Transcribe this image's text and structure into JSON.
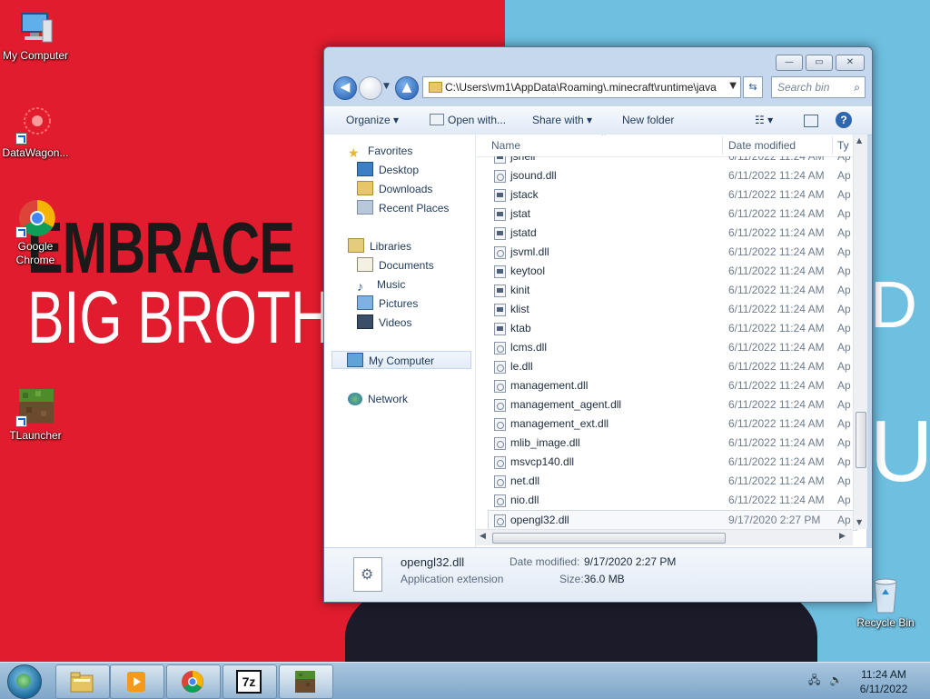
{
  "desktop": {
    "wallpaper": {
      "line1": "EMBRACE",
      "line2": "BIG BROTHER",
      "right_fragment1": "D",
      "right_fragment2": "UD",
      "colors": {
        "left": "#e11c2e",
        "right": "#6fbfe1"
      }
    },
    "icons": [
      {
        "label": "My Computer",
        "icon": "computer-icon"
      },
      {
        "label": "DataWagon...",
        "icon": "datawagon-icon"
      },
      {
        "label": "Google Chrome",
        "icon": "chrome-icon"
      },
      {
        "label": "TLauncher",
        "icon": "grass-block-icon"
      },
      {
        "label": "Recycle Bin",
        "icon": "recycle-bin-icon"
      }
    ]
  },
  "window": {
    "caption_buttons": {
      "minimize": "—",
      "maximize": "▭",
      "close": "✕"
    },
    "address": "C:\\Users\\vm1\\AppData\\Roaming\\.minecraft\\runtime\\java",
    "search_placeholder": "Search bin",
    "toolbar": {
      "organize": "Organize ▾",
      "open_with": "Open with...",
      "share_with": "Share with ▾",
      "new_folder": "New folder",
      "views": "☷ ▾"
    },
    "nav": {
      "favorites": "Favorites",
      "desktop": "Desktop",
      "downloads": "Downloads",
      "recent": "Recent Places",
      "libraries": "Libraries",
      "documents": "Documents",
      "music": "Music",
      "pictures": "Pictures",
      "videos": "Videos",
      "computer": "My Computer",
      "network": "Network"
    },
    "columns": {
      "name": "Name",
      "date": "Date modified",
      "type": "Ty"
    },
    "files": [
      {
        "name": "jshell",
        "date": "6/11/2022 11:24 AM",
        "type": "Ap",
        "kind": "exe"
      },
      {
        "name": "jsound.dll",
        "date": "6/11/2022 11:24 AM",
        "type": "Ap",
        "kind": "dll"
      },
      {
        "name": "jstack",
        "date": "6/11/2022 11:24 AM",
        "type": "Ap",
        "kind": "exe"
      },
      {
        "name": "jstat",
        "date": "6/11/2022 11:24 AM",
        "type": "Ap",
        "kind": "exe"
      },
      {
        "name": "jstatd",
        "date": "6/11/2022 11:24 AM",
        "type": "Ap",
        "kind": "exe"
      },
      {
        "name": "jsvml.dll",
        "date": "6/11/2022 11:24 AM",
        "type": "Ap",
        "kind": "dll"
      },
      {
        "name": "keytool",
        "date": "6/11/2022 11:24 AM",
        "type": "Ap",
        "kind": "exe"
      },
      {
        "name": "kinit",
        "date": "6/11/2022 11:24 AM",
        "type": "Ap",
        "kind": "exe"
      },
      {
        "name": "klist",
        "date": "6/11/2022 11:24 AM",
        "type": "Ap",
        "kind": "exe"
      },
      {
        "name": "ktab",
        "date": "6/11/2022 11:24 AM",
        "type": "Ap",
        "kind": "exe"
      },
      {
        "name": "lcms.dll",
        "date": "6/11/2022 11:24 AM",
        "type": "Ap",
        "kind": "dll"
      },
      {
        "name": "le.dll",
        "date": "6/11/2022 11:24 AM",
        "type": "Ap",
        "kind": "dll"
      },
      {
        "name": "management.dll",
        "date": "6/11/2022 11:24 AM",
        "type": "Ap",
        "kind": "dll"
      },
      {
        "name": "management_agent.dll",
        "date": "6/11/2022 11:24 AM",
        "type": "Ap",
        "kind": "dll"
      },
      {
        "name": "management_ext.dll",
        "date": "6/11/2022 11:24 AM",
        "type": "Ap",
        "kind": "dll"
      },
      {
        "name": "mlib_image.dll",
        "date": "6/11/2022 11:24 AM",
        "type": "Ap",
        "kind": "dll"
      },
      {
        "name": "msvcp140.dll",
        "date": "6/11/2022 11:24 AM",
        "type": "Ap",
        "kind": "dll"
      },
      {
        "name": "net.dll",
        "date": "6/11/2022 11:24 AM",
        "type": "Ap",
        "kind": "dll"
      },
      {
        "name": "nio.dll",
        "date": "6/11/2022 11:24 AM",
        "type": "Ap",
        "kind": "dll"
      },
      {
        "name": "opengl32.dll",
        "date": "9/17/2020 2:27 PM",
        "type": "Ap",
        "kind": "dll"
      }
    ],
    "details": {
      "name": "opengl32.dll",
      "type": "Application extension",
      "date_label": "Date modified:",
      "date_value": "9/17/2020 2:27 PM",
      "size_label": "Size:",
      "size_value": "36.0 MB"
    }
  },
  "taskbar": {
    "buttons": [
      "explorer-icon",
      "media-player-icon",
      "chrome-icon",
      "7zip-icon",
      "grass-block-icon"
    ],
    "sevenzip": "7z",
    "time": "11:24 AM",
    "date": "6/11/2022"
  }
}
